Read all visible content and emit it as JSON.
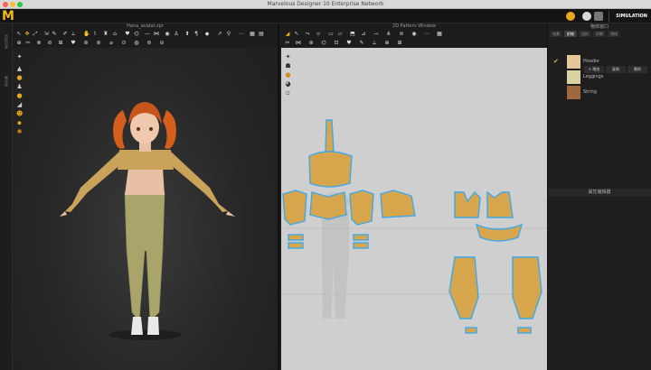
{
  "window": {
    "title": "Marvelous Designer 10 Enterprise Network",
    "logo_text": "M",
    "simulation_label": "SIMULATION"
  },
  "left_strip": {
    "labels": [
      "历史记录",
      "模块库"
    ]
  },
  "view3d": {
    "title": "Hana_avatar.zpr"
  },
  "view2d": {
    "title": "2D Pattern Window"
  },
  "right_panel": {
    "title": "物体窗口",
    "tabs": [
      "场景",
      "织物",
      "纽扣",
      "扣眼",
      "明线"
    ],
    "add_label": "+ 增加",
    "btn2": "复制",
    "btn3": "删除",
    "fabrics": [
      {
        "name": "Hoodie",
        "checked": true,
        "swatch": "#e6c79a"
      },
      {
        "name": "Leggings",
        "checked": false,
        "swatch": "#d8d3a0"
      },
      {
        "name": "String",
        "checked": false,
        "swatch": "#a0683f"
      }
    ],
    "property_title": "属性编辑器"
  },
  "colors": {
    "accent": "#f3b81a",
    "pattern_fill": "#d7a64c",
    "pattern_outline": "#3fa8e8"
  }
}
